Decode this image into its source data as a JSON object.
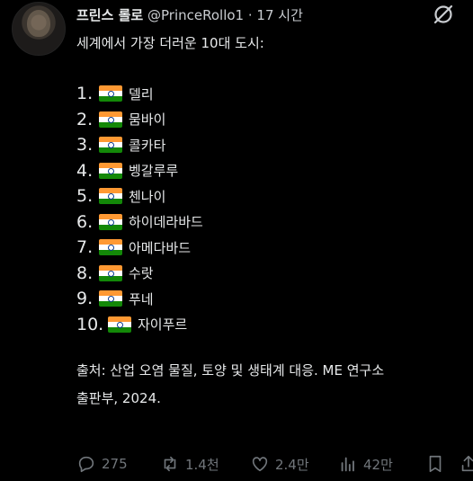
{
  "post": {
    "author_name": "프린스 롤로",
    "author_handle": "@PrinceRollo1",
    "time": "· 17 시간",
    "title": "세계에서 가장 더러운 10대 도시:",
    "items": [
      {
        "num": "1.",
        "city": "델리"
      },
      {
        "num": "2.",
        "city": "뭄바이"
      },
      {
        "num": "3.",
        "city": "콜카타"
      },
      {
        "num": "4.",
        "city": "벵갈루루"
      },
      {
        "num": "5.",
        "city": "첸나이"
      },
      {
        "num": "6.",
        "city": "하이데라바드"
      },
      {
        "num": "7.",
        "city": "아메다바드"
      },
      {
        "num": "8.",
        "city": "수랏"
      },
      {
        "num": "9.",
        "city": "푸네"
      },
      {
        "num": "10.",
        "city": "자이푸르"
      }
    ],
    "source_line1": "출처: 산업 오염 물질, 토양 및 생태계 대응. ME 연구소",
    "source_line2": "출판부, 2024."
  },
  "actions": {
    "replies": "275",
    "reposts": "1.4천",
    "likes": "2.4만",
    "views": "42만"
  },
  "icons": {
    "flag": "india-flag-icon",
    "header_right": "grok-icon",
    "reply": "reply-icon",
    "repost": "repost-icon",
    "like": "heart-icon",
    "views": "views-icon",
    "bookmark": "bookmark-icon"
  }
}
